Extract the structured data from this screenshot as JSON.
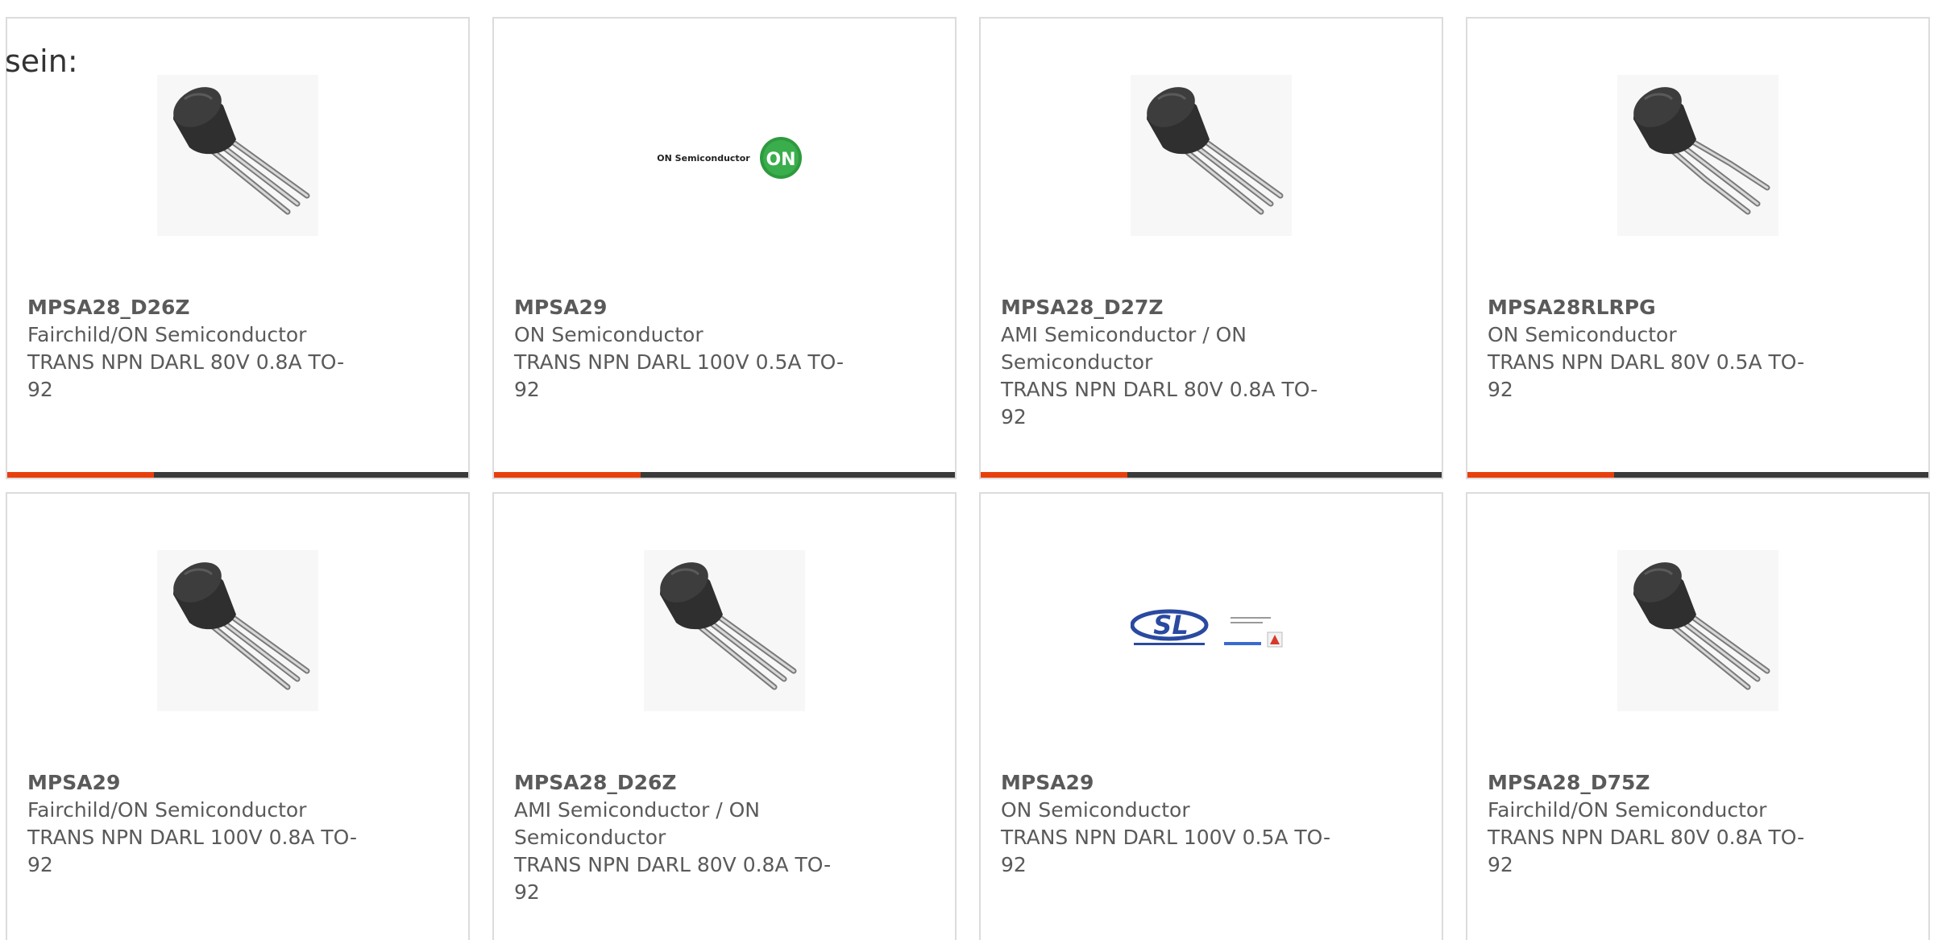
{
  "heading": "sein:",
  "colors": {
    "accent": "#e8400c",
    "bar": "#3a3a3a",
    "border": "#dcdcdc"
  },
  "cards": [
    {
      "part": "MPSA28_D26Z",
      "manufacturer": "Fairchild/ON Semiconductor",
      "description": "TRANS NPN DARL 80V 0.8A TO-92",
      "image": "transistor-to92-image"
    },
    {
      "part": "MPSA29",
      "manufacturer": "ON Semiconductor",
      "description": "TRANS NPN DARL 100V 0.5A TO-92",
      "image": "on-semiconductor-logo",
      "logo_text": "ON Semiconductor",
      "logo_badge": "ON"
    },
    {
      "part": "MPSA28_D27Z",
      "manufacturer": "AMI Semiconductor / ON Semiconductor",
      "description": "TRANS NPN DARL 80V 0.8A TO-92",
      "image": "transistor-to92-image"
    },
    {
      "part": "MPSA28RLRPG",
      "manufacturer": "ON Semiconductor",
      "description": "TRANS NPN DARL 80V 0.5A TO-92",
      "image": "transistor-to92-image"
    },
    {
      "part": "MPSA29",
      "manufacturer": "Fairchild/ON Semiconductor",
      "description": "TRANS NPN DARL 100V 0.8A TO-92",
      "image": "transistor-to92-image"
    },
    {
      "part": "MPSA28_D26Z",
      "manufacturer": "AMI Semiconductor / ON Semiconductor",
      "description": "TRANS NPN DARL 80V 0.8A TO-92",
      "image": "transistor-to92-image"
    },
    {
      "part": "MPSA29",
      "manufacturer": "ON Semiconductor",
      "description": "TRANS NPN DARL 100V 0.5A TO-92",
      "image": "sl-power-electronics-logo",
      "logo_text": "SL"
    },
    {
      "part": "MPSA28_D75Z",
      "manufacturer": "Fairchild/ON Semiconductor",
      "description": "TRANS NPN DARL 80V 0.8A TO-92",
      "image": "transistor-to92-image"
    }
  ]
}
